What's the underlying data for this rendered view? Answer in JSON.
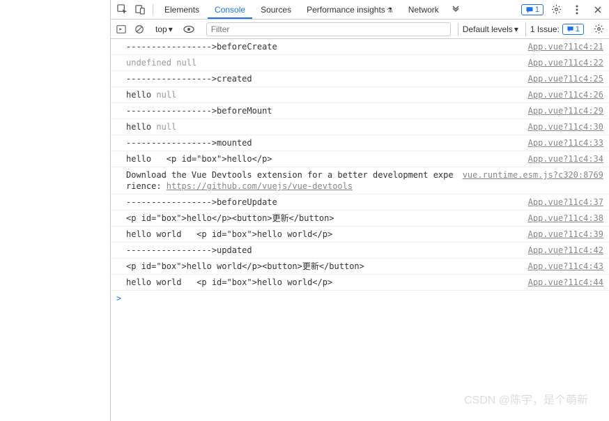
{
  "tabs": {
    "elements": "Elements",
    "console": "Console",
    "sources": "Sources",
    "perf": "Performance insights",
    "network": "Network"
  },
  "msg_badge": "1",
  "toolbar": {
    "context": "top",
    "filter_placeholder": "Filter",
    "levels": "Default levels",
    "issues_label": "1 Issue:",
    "issues_count": "1"
  },
  "logs": [
    {
      "text": "----------------->beforeCreate",
      "src": "App.vue?11c4:21"
    },
    {
      "segments": [
        {
          "t": "undefined",
          "c": "und"
        },
        {
          "t": " "
        },
        {
          "t": "null",
          "c": "und"
        }
      ],
      "src": "App.vue?11c4:22"
    },
    {
      "text": "----------------->created",
      "src": "App.vue?11c4:25"
    },
    {
      "segments": [
        {
          "t": "hello "
        },
        {
          "t": "null",
          "c": "und"
        }
      ],
      "src": "App.vue?11c4:26"
    },
    {
      "text": "----------------->beforeMount",
      "src": "App.vue?11c4:29"
    },
    {
      "segments": [
        {
          "t": "hello "
        },
        {
          "t": "null",
          "c": "und"
        }
      ],
      "src": "App.vue?11c4:30"
    },
    {
      "text": "----------------->mounted",
      "src": "App.vue?11c4:33"
    },
    {
      "text": "hello   <p id=\"box\">hello</p>",
      "src": "App.vue?11c4:34"
    },
    {
      "segments": [
        {
          "t": "Download the Vue Devtools extension for a better development experience: "
        },
        {
          "t": "https://github.com/vuejs/vue-devtools",
          "c": "link-inline"
        }
      ],
      "src": "vue.runtime.esm.js?c320:8769"
    },
    {
      "text": "----------------->beforeUpdate",
      "src": "App.vue?11c4:37"
    },
    {
      "text": "<p id=\"box\">hello</p><button>更新</button>",
      "src": "App.vue?11c4:38"
    },
    {
      "text": "hello world   <p id=\"box\">hello world</p>",
      "src": "App.vue?11c4:39"
    },
    {
      "text": "----------------->updated",
      "src": "App.vue?11c4:42"
    },
    {
      "text": "<p id=\"box\">hello world</p><button>更新</button>",
      "src": "App.vue?11c4:43"
    },
    {
      "text": "hello world   <p id=\"box\">hello world</p>",
      "src": "App.vue?11c4:44"
    }
  ],
  "prompt": ">",
  "watermark": "CSDN @陈宇，是个萌新"
}
